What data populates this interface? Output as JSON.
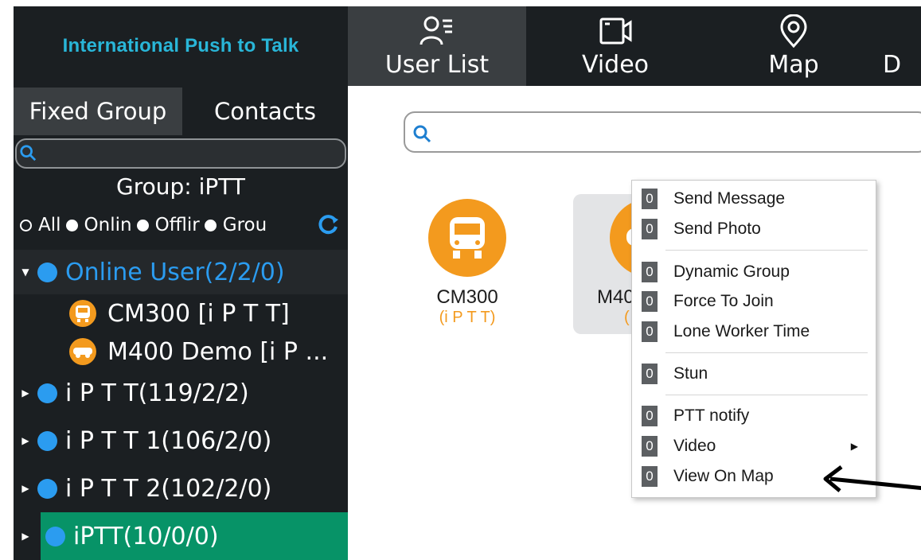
{
  "app": {
    "brand": "International Push to Talk"
  },
  "nav": {
    "items": [
      {
        "label": "User List",
        "icon": "user-list-icon",
        "active": true
      },
      {
        "label": "Video",
        "icon": "video-camera-icon",
        "active": false
      },
      {
        "label": "Map",
        "icon": "map-pin-icon",
        "active": false
      },
      {
        "label": "D",
        "icon": "",
        "active": false
      }
    ]
  },
  "sidebar": {
    "tabs": [
      "Fixed Group",
      "Contacts"
    ],
    "search": {
      "placeholder": ""
    },
    "group_title": "Group:  iPTT",
    "filters": [
      "All",
      "Onlin",
      "Offlir",
      "Grou"
    ],
    "tree": {
      "online": "Online User(2/2/0)",
      "users": [
        "CM300 [i P T T]",
        "M400 Demo [i P ..."
      ],
      "groups": [
        "i P T T(119/2/2)",
        "i P T T 1(106/2/0)",
        "i P T T 2(102/2/0)",
        "iPTT(10/0/0)"
      ]
    }
  },
  "main": {
    "search": {
      "placeholder": ""
    },
    "cards": [
      {
        "name": "CM300",
        "sub": "(i P T T)"
      },
      {
        "name": "M40",
        "sub": "("
      }
    ]
  },
  "context_menu": {
    "badge": "0",
    "items": [
      "Send Message",
      "Send Photo",
      "Dynamic Group",
      "Force To Join",
      "Lone Worker Time",
      "Stun",
      "PTT notify",
      "Video",
      "View On Map"
    ]
  },
  "colors": {
    "accent": "#29b6d8",
    "online": "#2b9cf0",
    "selected": "#079367",
    "avatar": "#f39a1e",
    "panel": "#1b1f22"
  }
}
